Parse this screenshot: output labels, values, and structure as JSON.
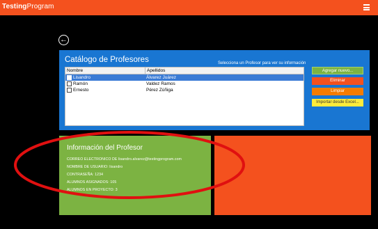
{
  "app": {
    "title_bold": "Testing",
    "title_rest": "Program"
  },
  "catalog": {
    "title": "Catálogo de Profesores",
    "hint": "Selecciona un Profesor para ver su información",
    "columns": [
      "Nombre",
      "Apellidos"
    ],
    "rows": [
      {
        "nombre": "Lisandro",
        "apellidos": "Álvarez Juárez",
        "selected": true
      },
      {
        "nombre": "Ramón",
        "apellidos": "Valdez Ramos",
        "selected": false
      },
      {
        "nombre": "Ernesto",
        "apellidos": "Pérez Zúñiga",
        "selected": false
      }
    ]
  },
  "actions": {
    "add": "Agregar nuevo...",
    "delete": "Eliminar",
    "clear": "Limpiar",
    "import": "Importar desde Excel..."
  },
  "info": {
    "title": "Información del Profesor",
    "lines": [
      "CORREO ELECTRONICO DE lisandro.alvarez@testingprogram.com",
      "NOMBRE DE USUARIO: lisandro",
      "CONTRASEÑA: 1234",
      "ALUMNOS ASIGNADOS: 105",
      "ALUMNOS EN PROYECTO: 3"
    ]
  },
  "colors": {
    "topbar": "#f4511e",
    "catalog_bg": "#1976d2",
    "info_bg": "#7cb342",
    "tile_bg": "#f4511e",
    "annotation": "#e01010"
  }
}
